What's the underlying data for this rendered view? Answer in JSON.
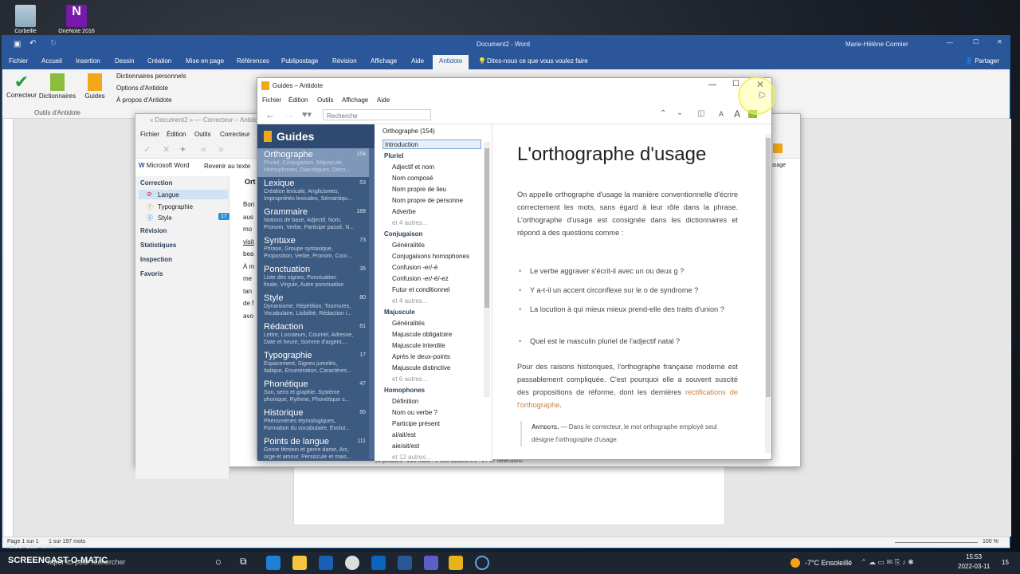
{
  "desktop": {
    "icons": [
      {
        "label": "Corbeille"
      },
      {
        "label": "OneNote 2016"
      }
    ]
  },
  "word": {
    "title": "Document2 - Word",
    "user": "Marie-Hélène Cormier",
    "tabs": [
      "Fichier",
      "Accueil",
      "Insertion",
      "Dessin",
      "Création",
      "Mise en page",
      "Références",
      "Publipostage",
      "Révision",
      "Affichage",
      "Aide",
      "Antidote"
    ],
    "tell_me": "Dites-nous ce que vous voulez faire",
    "share": "Partager",
    "ribbon": {
      "btn_correcteur": "Correcteur",
      "btn_dictionnaires": "Dictionnaires",
      "btn_guides": "Guides",
      "links": [
        "Dictionnaires personnels",
        "Options d'Antidote",
        "À propos d'Antidote"
      ],
      "group": "Outils d'Antidote"
    },
    "status": {
      "page": "Page 1 sur 1",
      "words": "1 sur 197 mots",
      "zoom": "100 %"
    }
  },
  "corrector": {
    "title": "« Document2 » — Correcteur – Antidote",
    "menu": [
      "Fichier",
      "Édition",
      "Outils",
      "Correcteur"
    ],
    "word_btn": "Microsoft Word",
    "back_btn": "Revenir au texte",
    "nav": {
      "correction": "Correction",
      "langue": "Langue",
      "typographie": "Typographie",
      "style": "Style",
      "style_count": "17",
      "revision": "Révision",
      "statistiques": "Statistiques",
      "inspection": "Inspection",
      "favoris": "Favoris"
    },
    "heading": "Ort",
    "lines": [
      "Bon",
      "aus",
      "mo",
      "visit",
      "bea",
      "À m",
      "me",
      "tan",
      "de f",
      "avo"
    ],
    "status": "14 phrases · 215 mots · 1 156 caractères · 0 / 17 détections",
    "usage": "usage"
  },
  "guides": {
    "title": "Guides – Antidote",
    "menu": [
      "Fichier",
      "Édition",
      "Outils",
      "Affichage",
      "Aide"
    ],
    "search_placeholder": "Recherche",
    "header": "Guides",
    "categories": [
      {
        "name": "Orthographe",
        "count": "154",
        "desc1": "Pluriel, Conjugaison, Majuscule,",
        "desc2": "Homophones, Diacritiques, Déco..."
      },
      {
        "name": "Lexique",
        "count": "53",
        "desc1": "Création lexicale, Anglicismes,",
        "desc2": "Impropriétés lexicales, Sémantiqu..."
      },
      {
        "name": "Grammaire",
        "count": "189",
        "desc1": "Notions de base, Adjectif, Nom,",
        "desc2": "Pronom, Verbe, Participe passé, N..."
      },
      {
        "name": "Syntaxe",
        "count": "73",
        "desc1": "Phrase, Groupe syntaxique,",
        "desc2": "Proposition, Verbe, Pronom, Coor..."
      },
      {
        "name": "Ponctuation",
        "count": "35",
        "desc1": "Liste des signes, Ponctuation",
        "desc2": "finale, Virgule, Autre ponctuation"
      },
      {
        "name": "Style",
        "count": "80",
        "desc1": "Dynamisme, Répétition, Tournures,",
        "desc2": "Vocabulaire, Lisibilité, Rédaction i..."
      },
      {
        "name": "Rédaction",
        "count": "61",
        "desc1": "Lettre, Locuteurs, Courriel, Adresse,",
        "desc2": "Date et heure, Somme d'argent,..."
      },
      {
        "name": "Typographie",
        "count": "17",
        "desc1": "Espacement, Signes jumelés,",
        "desc2": "Italique, Énumération, Caractères..."
      },
      {
        "name": "Phonétique",
        "count": "47",
        "desc1": "Son, sens et graphie, Système",
        "desc2": "phonique, Rythme, Phonétique s..."
      },
      {
        "name": "Historique",
        "count": "95",
        "desc1": "Phénomènes étymologiques,",
        "desc2": "Formation du vocabulaire, Évolut..."
      },
      {
        "name": "Points de langue",
        "count": "111",
        "desc1": "Genre féminin et genre dame, Arc,",
        "desc2": "orge et amour, Pérsiscule et mais..."
      }
    ],
    "toc": {
      "root": "Orthographe (154)",
      "intro": "Introduction",
      "sections": [
        {
          "title": "Pluriel",
          "items": [
            "Adjectif et nom",
            "Nom composé",
            "Nom propre de lieu",
            "Nom propre de personne",
            "Adverbe"
          ],
          "more": "et 4 autres..."
        },
        {
          "title": "Conjugaison",
          "items": [
            "Généralités",
            "Conjugaisons homophones",
            "Confusion -er/-é",
            "Confusion -er/-é/-ez",
            "Futur et conditionnel"
          ],
          "more": "et 4 autres..."
        },
        {
          "title": "Majuscule",
          "items": [
            "Généralités",
            "Majuscule obligatoire",
            "Majuscule interdite",
            "Après le deux-points",
            "Majuscule distinctive"
          ],
          "more": "et 6 autres..."
        },
        {
          "title": "Homophones",
          "items": [
            "Définition",
            "Nom ou verbe ?",
            "Participe présent",
            "ai/ait/est",
            "aie/ait/est"
          ],
          "more": "et 12 autres..."
        }
      ]
    },
    "article": {
      "title": "L'orthographe d'usage",
      "p1": "On appelle orthographe d'usage la manière conventionnelle d'écrire correctement les mots, sans égard à leur rôle dans la phrase. L'orthographe d'usage est consignée dans les dictionnaires et répond à des questions comme :",
      "bullets": [
        "Le verbe aggraver s'écrit-il avec un ou deux g ?",
        "Y a-t-il un accent circonflexe sur le o de syndrome ?",
        "La locution à qui mieux mieux prend-elle des traits d'union ?",
        "Quel est le masculin pluriel de l'adjectif natal ?"
      ],
      "p2a": "Pour des raisons historiques, l'orthographe française moderne est passablement compliquée. C'est pourquoi elle a souvent suscité des propositions de réforme, dont les dernières ",
      "p2link": "rectifications de l'orthographe",
      "p2b": ".",
      "note_label": "Antidote.",
      "note": " — Dans le correcteur, le mot orthographe employé seul désigne l'orthographe d'usage."
    }
  },
  "taskbar": {
    "search": "Taper ici pour rechercher",
    "weather": "-7°C Ensoleillé",
    "time": "15:53",
    "date": "2022-03-11",
    "notif": "15",
    "watermark": "RECORDED WITH",
    "brand": "SCREENCAST-O-MATIC"
  },
  "colors": {
    "word_blue": "#2b579a",
    "guides_nav": "#3d5a80",
    "link_orange": "#c9813a"
  }
}
